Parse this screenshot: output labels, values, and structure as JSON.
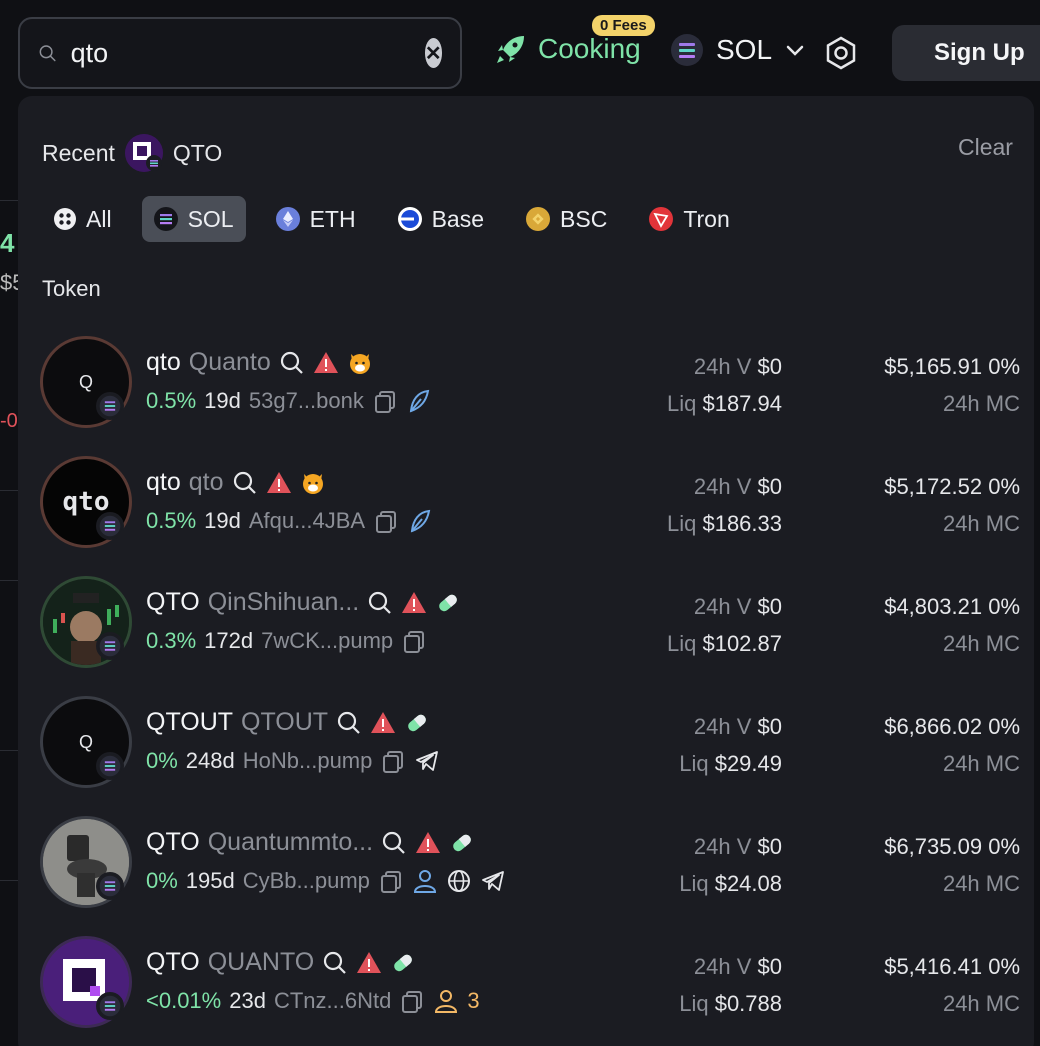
{
  "search": {
    "value": "qto",
    "placeholder": ""
  },
  "header": {
    "cooking_label": "Cooking",
    "fees_badge": "0 Fees",
    "chain": "SOL",
    "signup_label": "Sign Up"
  },
  "dropdown": {
    "recent_label": "Recent",
    "recent_item": "QTO",
    "clear_label": "Clear",
    "section_label": "Token",
    "chips": [
      {
        "label": "All",
        "icon": "grid-icon",
        "active": false
      },
      {
        "label": "SOL",
        "icon": "solana-icon",
        "active": true
      },
      {
        "label": "ETH",
        "icon": "ethereum-icon",
        "active": false
      },
      {
        "label": "Base",
        "icon": "base-icon",
        "active": false
      },
      {
        "label": "BSC",
        "icon": "bsc-icon",
        "active": false
      },
      {
        "label": "Tron",
        "icon": "tron-icon",
        "active": false
      }
    ],
    "tokens": [
      {
        "symbol": "qto",
        "name": "Quanto",
        "change": "0.5%",
        "age": "19d",
        "address": "53g7...bonk",
        "vol_label": "24h V",
        "vol": "$0",
        "liq_label": "Liq",
        "liq": "$187.94",
        "price": "$5,165.91",
        "pct": "0%",
        "mc_label": "24h MC",
        "avatar_text": "Q"
      },
      {
        "symbol": "qto",
        "name": "qto",
        "change": "0.5%",
        "age": "19d",
        "address": "Afqu...4JBA",
        "vol_label": "24h V",
        "vol": "$0",
        "liq_label": "Liq",
        "liq": "$186.33",
        "price": "$5,172.52",
        "pct": "0%",
        "mc_label": "24h MC",
        "avatar_text": "qto"
      },
      {
        "symbol": "QTO",
        "name": "QinShihuan...",
        "change": "0.3%",
        "age": "172d",
        "address": "7wCK...pump",
        "vol_label": "24h V",
        "vol": "$0",
        "liq_label": "Liq",
        "liq": "$102.87",
        "price": "$4,803.21",
        "pct": "0%",
        "mc_label": "24h MC",
        "avatar_text": ""
      },
      {
        "symbol": "QTOUT",
        "name": "QTOUT",
        "change": "0%",
        "age": "248d",
        "address": "HoNb...pump",
        "vol_label": "24h V",
        "vol": "$0",
        "liq_label": "Liq",
        "liq": "$29.49",
        "price": "$6,866.02",
        "pct": "0%",
        "mc_label": "24h MC",
        "avatar_text": "Q"
      },
      {
        "symbol": "QTO",
        "name": "Quantummto...",
        "change": "0%",
        "age": "195d",
        "address": "CyBb...pump",
        "vol_label": "24h V",
        "vol": "$0",
        "liq_label": "Liq",
        "liq": "$24.08",
        "price": "$6,735.09",
        "pct": "0%",
        "mc_label": "24h MC",
        "avatar_text": ""
      },
      {
        "symbol": "QTO",
        "name": "QUANTO",
        "change": "<0.01%",
        "age": "23d",
        "address": "CTnz...6Ntd",
        "vol_label": "24h V",
        "vol": "$0",
        "liq_label": "Liq",
        "liq": "$0.788",
        "price": "$5,416.41",
        "pct": "0%",
        "mc_label": "24h MC",
        "avatar_text": "",
        "holders": "3"
      }
    ]
  },
  "background": {
    "left_number": "4",
    "left_dollar": "$5",
    "left_neg": "-0"
  }
}
